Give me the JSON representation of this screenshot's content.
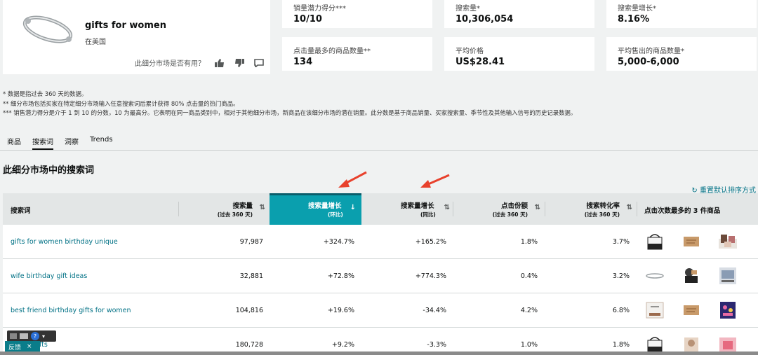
{
  "product": {
    "title": "gifts for women",
    "region": "在美国",
    "useful_prompt": "此细分市场是否有用？"
  },
  "metrics": [
    {
      "label": "销量潜力得分***",
      "value": "10/10"
    },
    {
      "label": "搜索量*",
      "value": "10,306,054"
    },
    {
      "label": "搜索量增长*",
      "value": "8.16%"
    },
    {
      "label": "点击量最多的商品数量**",
      "value": "134"
    },
    {
      "label": "平均价格",
      "value": "US$28.41"
    },
    {
      "label": "平均售出的商品数量*",
      "value": "5,000-6,000"
    }
  ],
  "notes": [
    "* 数据是指过去 360 天的数据。",
    "** 细分市场包括买家在特定细分市场输入任意搜索词后累计获得 80% 点击量的热门商品。",
    "*** 销售潜力得分是介于 1 到 10 的分数，10 为最高分。它表明在同一商品类别中，相对于其他细分市场，新商品在该细分市场的潜在销量。此分数是基于商品销量、买家搜索量、季节性及其他输入信号的历史记录数据。"
  ],
  "tabs": [
    "商品",
    "搜索词",
    "洞察",
    "Trends"
  ],
  "section_title": "此细分市场中的搜索词",
  "reset_label": "重置默认排序方式",
  "headers": {
    "keyword": "搜索词",
    "volume": "搜索量",
    "volume_sub": "(过去 360 天)",
    "growth_qoq": "搜索量增长",
    "growth_qoq_sub": "(环比)",
    "growth_yoy": "搜索量增长",
    "growth_yoy_sub": "(同比)",
    "click_share": "点击份额",
    "click_share_sub": "(过去 360 天)",
    "conversion": "搜索转化率",
    "conversion_sub": "(过去 360 天)",
    "top_products": "点击次数最多的 3 件商品"
  },
  "rows": [
    {
      "keyword": "gifts for women birthday unique",
      "volume": "97,987",
      "qoq": "+324.7%",
      "yoy": "+165.2%",
      "click": "1.8%",
      "conv": "3.7%"
    },
    {
      "keyword": "wife birthday gift ideas",
      "volume": "32,881",
      "qoq": "+72.8%",
      "yoy": "+774.3%",
      "click": "0.4%",
      "conv": "3.2%"
    },
    {
      "keyword": "best friend birthday gifts for women",
      "volume": "104,816",
      "qoq": "+19.6%",
      "yoy": "-34.4%",
      "click": "4.2%",
      "conv": "6.8%"
    },
    {
      "keyword": "",
      "volume": "180,728",
      "qoq": "+9.2%",
      "yoy": "-3.3%",
      "click": "1.0%",
      "conv": "1.8%"
    }
  ],
  "row4_keyword_fragment": "fts",
  "feedback": {
    "label": "反馈",
    "close": "×",
    "help": "?"
  },
  "colors": {
    "accent": "#0a9fae",
    "link": "#007185",
    "arrow": "#e8412c"
  }
}
